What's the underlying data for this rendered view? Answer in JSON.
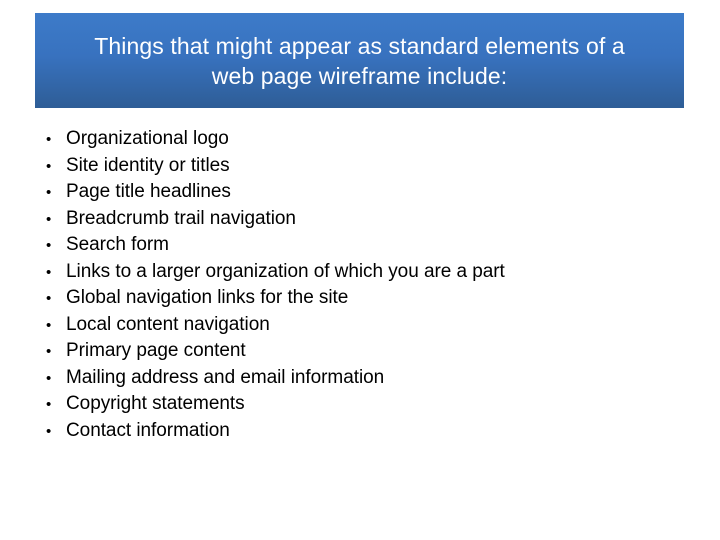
{
  "slide": {
    "background_color": "#ffffff",
    "title": {
      "text": "Things that might appear as standard elements of a\nweb page wireframe include:",
      "text_color": "#ffffff",
      "gradient_top_color": "#3d7bc9",
      "gradient_bottom_color": "#2e5d96"
    },
    "bullets": {
      "marker": "•",
      "text_color": "#000000",
      "items": [
        {
          "label": "Organizational logo"
        },
        {
          "label": "Site identity or titles"
        },
        {
          "label": "Page title headlines"
        },
        {
          "label": "Breadcrumb trail navigation"
        },
        {
          "label": "Search form"
        },
        {
          "label": "Links to a larger organization of which you are a part"
        },
        {
          "label": "Global navigation links for the site"
        },
        {
          "label": "Local content navigation"
        },
        {
          "label": "Primary page content"
        },
        {
          "label": "Mailing address and email information"
        },
        {
          "label": "Copyright statements"
        },
        {
          "label": "Contact information"
        }
      ]
    }
  }
}
